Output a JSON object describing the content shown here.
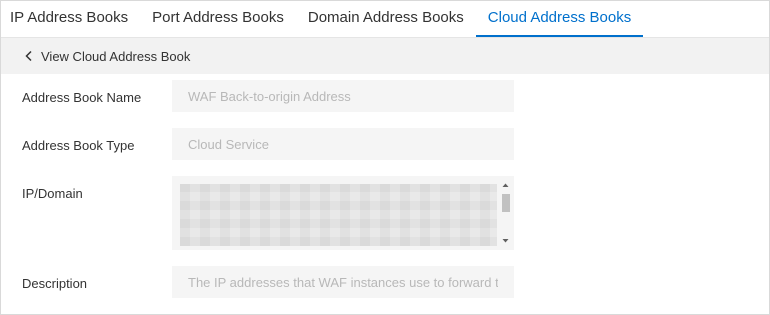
{
  "tabs": [
    {
      "label": "IP Address Books",
      "active": false
    },
    {
      "label": "Port Address Books",
      "active": false
    },
    {
      "label": "Domain Address Books",
      "active": false
    },
    {
      "label": "Cloud Address Books",
      "active": true
    }
  ],
  "back": {
    "label": "View Cloud Address Book",
    "icon": "chevron-left-icon"
  },
  "form": {
    "name": {
      "label": "Address Book Name",
      "value": "WAF Back-to-origin Address"
    },
    "type": {
      "label": "Address Book Type",
      "value": "Cloud Service"
    },
    "ip_domain": {
      "label": "IP/Domain",
      "value": ""
    },
    "description": {
      "label": "Description",
      "value": "The IP addresses that WAF instances use to forward tr"
    }
  },
  "colors": {
    "accent": "#0070cc",
    "field_bg": "#f5f5f5",
    "back_bar_bg": "#f2f2f2"
  }
}
